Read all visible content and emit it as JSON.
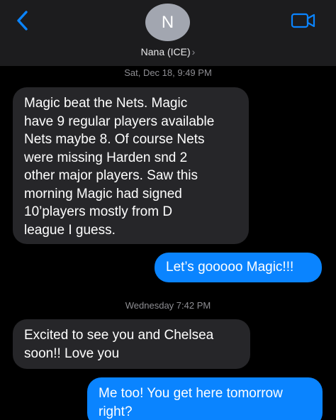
{
  "header": {
    "back_icon": "chevron-left-icon",
    "avatar_initial": "N",
    "contact_name": "Nana (ICE)",
    "contact_chevron": "›",
    "video_icon": "video-camera-icon",
    "accent_color": "#0a84ff"
  },
  "thread": {
    "timestamps": [
      "Sat, Dec 18, 9:49 PM",
      "Wednesday 7:42 PM"
    ],
    "messages": [
      {
        "direction": "incoming",
        "text": "Magic beat the Nets.  Magic\nhave 9 regular players available\nNets maybe 8.  Of course Nets\nwere missing Harden snd 2\nother major players.  Saw this\nmorning Magic had signed\n10’players mostly from D\nleague I guess."
      },
      {
        "direction": "outgoing",
        "text": "Let’s gooooo Magic!!!"
      },
      {
        "direction": "incoming",
        "text": "Excited to see you and Chelsea\nsoon!! Love you"
      },
      {
        "direction": "outgoing",
        "text": "Me too! You get here tomorrow\nright?"
      }
    ]
  },
  "colors": {
    "incoming_bubble": "#262629",
    "outgoing_bubble": "#0a84ff",
    "header_background": "#1c1c1e",
    "background": "#000000"
  }
}
